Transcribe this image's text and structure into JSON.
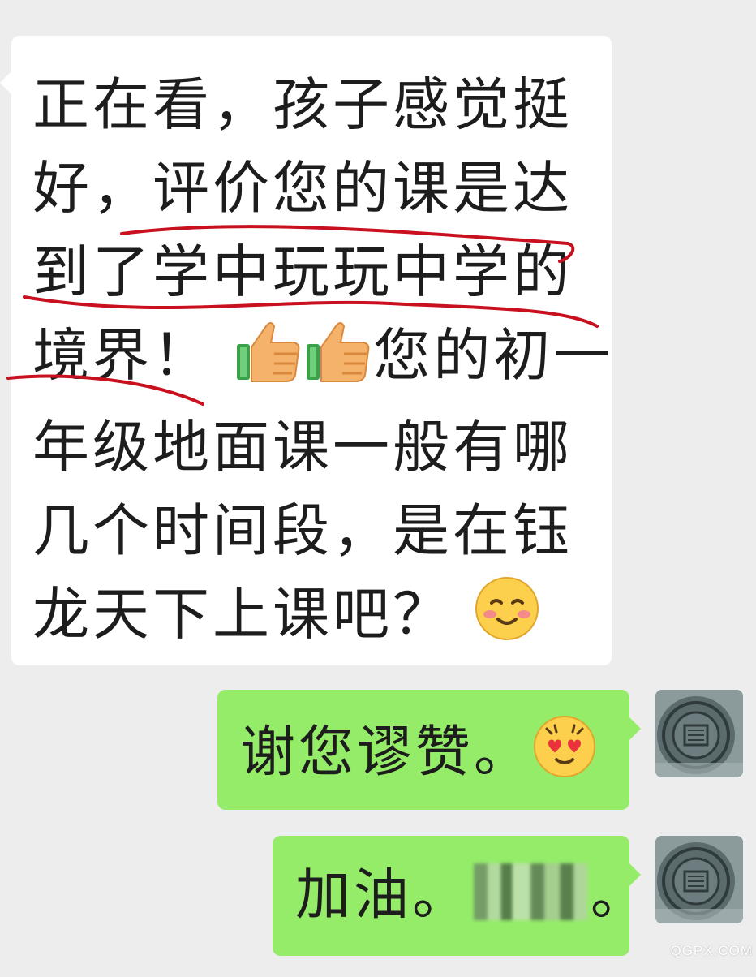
{
  "messages": {
    "incoming": {
      "line1": "正在看，孩子感觉挺",
      "line2": "好，评价您的课是达",
      "line3": "到了学中玩玩中学的",
      "line4_a": "境界！",
      "line4_b": "您的初一",
      "line5": "年级地面课一般有哪",
      "line6": "几个时间段，是在钰",
      "line7": "龙天下上课吧？",
      "emojis": [
        "thumbs-up",
        "thumbs-up",
        "smile-blush"
      ]
    },
    "outgoing": [
      {
        "text": "谢您谬赞。",
        "emoji": "heart-eyes"
      },
      {
        "text_a": "加油。",
        "text_b": "。"
      }
    ]
  },
  "watermark": "QGPX.COM",
  "colors": {
    "background": "#ededed",
    "incoming_bubble": "#ffffff",
    "outgoing_bubble": "#95ec69",
    "annotation_red": "#c8101e"
  }
}
